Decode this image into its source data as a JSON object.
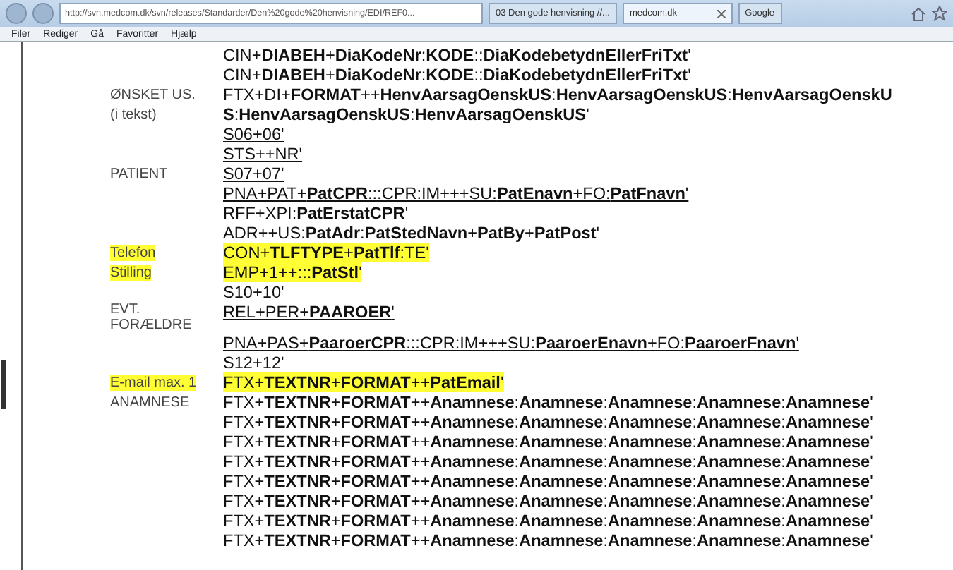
{
  "browser": {
    "address": "http://svn.medcom.dk/svn/releases/Standarder/Den%20gode%20henvisning/EDI/REF0...",
    "tabs": [
      {
        "label": "03 Den gode henvisning //...",
        "selected": false,
        "closable": false
      },
      {
        "label": "medcom.dk",
        "selected": true,
        "closable": true
      },
      {
        "label": "Google",
        "selected": false,
        "closable": false
      }
    ],
    "menu": [
      "Filer",
      "Rediger",
      "Gå",
      "Favoritter",
      "Hjælp"
    ]
  },
  "document": {
    "rows": [
      {
        "code": "CIN+**DIABEH**+**DiaKodeNr**:**KODE**::**DiaKodebetydnEllerFriTxt**'",
        "underlined": false,
        "highlighted": false
      },
      {
        "code": "CIN+**DIABEH**+**DiaKodeNr**:**KODE**::**DiaKodebetydnEllerFriTxt**'",
        "underlined": false,
        "highlighted": false
      },
      {
        "label": "ØNSKET US.",
        "label_highlighted": false,
        "code": "FTX+DI+**FORMAT**++**HenvAarsagOenskUS**:**HenvAarsagOenskUS**:**HenvAarsagOenskU**",
        "underlined": false,
        "highlighted": false
      },
      {
        "label": "(i tekst)",
        "label_highlighted": false,
        "code": "**S**:**HenvAarsagOenskUS**:**HenvAarsagOenskUS**'",
        "underlined": false,
        "highlighted": false
      },
      {
        "code": "S06+06'",
        "underlined": true,
        "highlighted": false
      },
      {
        "code": "STS++NR'",
        "underlined": true,
        "highlighted": false
      },
      {
        "label": "PATIENT",
        "label_highlighted": false,
        "code": "S07+07'",
        "underlined": true,
        "highlighted": false
      },
      {
        "code": "PNA+PAT+**PatCPR**:::CPR:IM+++SU:**PatEnavn**+FO:**PatFnavn**'",
        "underlined": true,
        "highlighted": false
      },
      {
        "code": "RFF+XPI:**PatErstatCPR**'",
        "underlined": false,
        "highlighted": false
      },
      {
        "code": "ADR++US:**PatAdr**:**PatStedNavn**+**PatBy**+**PatPost**'",
        "underlined": false,
        "highlighted": false
      },
      {
        "label": "Telefon",
        "label_highlighted": true,
        "code": "CON+**TLFTYPE**+**PatTlf**:TE'",
        "underlined": false,
        "highlighted": true
      },
      {
        "label": "Stilling",
        "label_highlighted": true,
        "code": "EMP+1++:::**PatStl**'",
        "underlined": false,
        "highlighted": true
      },
      {
        "code": "S10+10'",
        "underlined": false,
        "highlighted": false
      },
      {
        "label": "EVT. FORÆLDRE",
        "label_highlighted": false,
        "code": "REL+PER+**PAAROER**'",
        "underlined": true,
        "highlighted": false
      },
      {
        "code": "PNA+PAS+**PaaroerCPR**:::CPR:IM+++SU:**PaaroerEnavn**+FO:**PaaroerFnavn**'",
        "underlined": true,
        "highlighted": false
      },
      {
        "code": "S12+12'",
        "underlined": false,
        "highlighted": false
      },
      {
        "label": "E-mail max. 1",
        "label_highlighted": true,
        "code": "FTX+**TEXTNR**+**FORMAT**++**PatEmail**'",
        "underlined": false,
        "highlighted": true
      },
      {
        "label": "ANAMNESE",
        "label_highlighted": false,
        "code": "FTX+**TEXTNR**+**FORMAT**++**Anamnese**:**Anamnese**:**Anamnese**:**Anamnese**:**Anamnese**'",
        "underlined": false,
        "highlighted": false
      },
      {
        "code": "FTX+**TEXTNR**+**FORMAT**++**Anamnese**:**Anamnese**:**Anamnese**:**Anamnese**:**Anamnese**'",
        "underlined": false,
        "highlighted": false
      },
      {
        "code": "FTX+**TEXTNR**+**FORMAT**++**Anamnese**:**Anamnese**:**Anamnese**:**Anamnese**:**Anamnese**'",
        "underlined": false,
        "highlighted": false
      },
      {
        "code": "FTX+**TEXTNR**+**FORMAT**++**Anamnese**:**Anamnese**:**Anamnese**:**Anamnese**:**Anamnese**'",
        "underlined": false,
        "highlighted": false
      },
      {
        "code": "FTX+**TEXTNR**+**FORMAT**++**Anamnese**:**Anamnese**:**Anamnese**:**Anamnese**:**Anamnese**'",
        "underlined": false,
        "highlighted": false
      },
      {
        "code": "FTX+**TEXTNR**+**FORMAT**++**Anamnese**:**Anamnese**:**Anamnese**:**Anamnese**:**Anamnese**'",
        "underlined": false,
        "highlighted": false
      },
      {
        "code": "FTX+**TEXTNR**+**FORMAT**++**Anamnese**:**Anamnese**:**Anamnese**:**Anamnese**:**Anamnese**'",
        "underlined": false,
        "highlighted": false
      },
      {
        "code": "FTX+**TEXTNR**+**FORMAT**++**Anamnese**:**Anamnese**:**Anamnese**:**Anamnese**:**Anamnese**'",
        "underlined": false,
        "highlighted": false
      }
    ]
  }
}
